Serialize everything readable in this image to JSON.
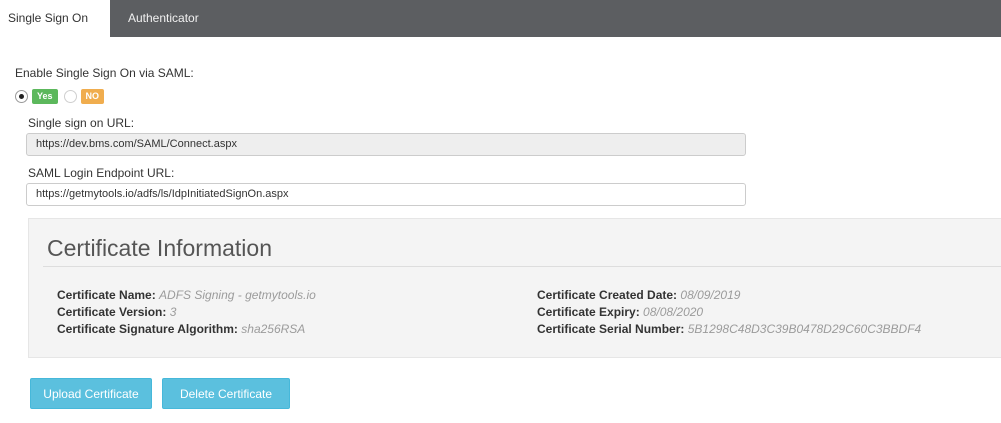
{
  "tabs": [
    {
      "label": "Single Sign On",
      "active": true
    },
    {
      "label": "Authenticator",
      "active": false
    }
  ],
  "saml": {
    "enable_label": "Enable Single Sign On via SAML:",
    "yes_label": "Yes",
    "no_label": "NO",
    "selected": "Yes"
  },
  "sso_url": {
    "label": "Single sign on URL:",
    "value": "https://dev.bms.com/SAML/Connect.aspx"
  },
  "login_endpoint": {
    "label": "SAML Login Endpoint URL:",
    "value": "https://getmytools.io/adfs/ls/IdpInitiatedSignOn.aspx"
  },
  "certificate": {
    "title": "Certificate Information",
    "name_label": "Certificate Name:",
    "name_value": "ADFS Signing - getmytools.io",
    "version_label": "Certificate Version:",
    "version_value": "3",
    "algorithm_label": "Certificate Signature Algorithm:",
    "algorithm_value": "sha256RSA",
    "created_label": "Certificate Created Date:",
    "created_value": "08/09/2019",
    "expiry_label": "Certificate Expiry:",
    "expiry_value": "08/08/2020",
    "serial_label": "Certificate Serial Number:",
    "serial_value": "5B1298C48D3C39B0478D29C60C3BBDF4"
  },
  "buttons": {
    "upload": "Upload Certificate",
    "delete": "Delete Certificate"
  },
  "colors": {
    "tabbar": "#5c5e61",
    "yes": "#5cb85c",
    "no": "#f0ad4e",
    "button": "#5bc0de"
  }
}
